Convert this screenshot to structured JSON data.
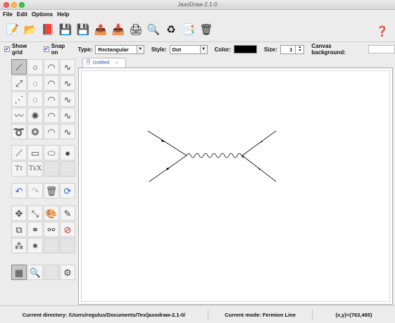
{
  "window": {
    "title": "JaxoDraw-2.1-0"
  },
  "menu": [
    "File",
    "Edit",
    "Options",
    "Help"
  ],
  "toolbar": {
    "buttons": [
      {
        "name": "new-icon",
        "glyph": "📝"
      },
      {
        "name": "open-icon",
        "glyph": "📂"
      },
      {
        "name": "import-icon",
        "glyph": "📕"
      },
      {
        "name": "save-icon",
        "glyph": "💾"
      },
      {
        "name": "save-as-icon",
        "glyph": "💾"
      },
      {
        "name": "export-icon",
        "glyph": "📤"
      },
      {
        "name": "print-export-icon",
        "glyph": "📥"
      },
      {
        "name": "print-icon",
        "glyph": "🖨"
      },
      {
        "name": "zoom-icon",
        "glyph": "🔍"
      },
      {
        "name": "refresh-icon",
        "glyph": "♻"
      },
      {
        "name": "preview-icon",
        "glyph": "📑"
      },
      {
        "name": "clean-icon",
        "glyph": "🗑"
      }
    ],
    "help_glyph": "❓"
  },
  "options": {
    "show_grid": "Show grid",
    "snap_on": "Snap on",
    "type_label": "Type:",
    "type_value": "Rectangular",
    "style_label": "Style:",
    "style_value": "Dot",
    "color_label": "Color:",
    "color_value": "#000000",
    "size_label": "Size:",
    "size_value": "1",
    "canvas_bg_label": "Canvas background:"
  },
  "tab": {
    "label": "Untitled"
  },
  "status": {
    "directory": "Current directory: /Users/regulus/Documents/Tex/jaxodraw-2.1-0/",
    "mode": "Current mode: Fermion Line",
    "coords": "(x,y)=(763,465)"
  }
}
